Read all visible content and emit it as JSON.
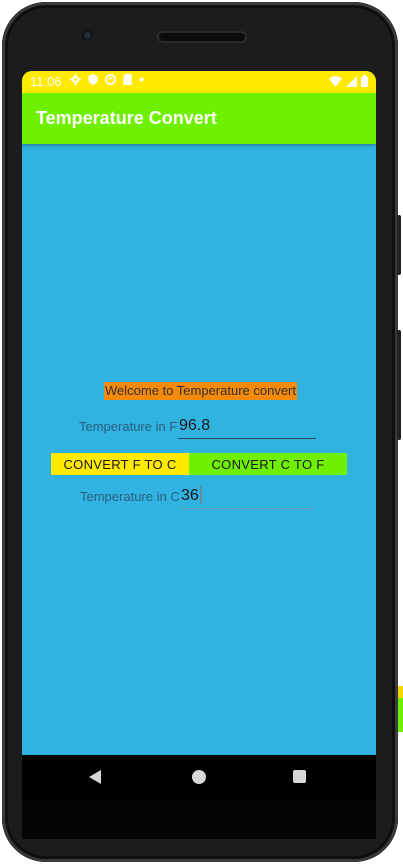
{
  "status_bar": {
    "time": "11:06",
    "left_icons": [
      "gear-icon",
      "shield-icon",
      "sync-icon",
      "sd-card-icon",
      "dot-icon"
    ],
    "right_icons": [
      "wifi-icon",
      "signal-icon",
      "battery-icon"
    ]
  },
  "app_bar": {
    "title": "Temperature Convert"
  },
  "main": {
    "welcome_text": "Welcome to Temperature convert",
    "fahrenheit_label": "Temperature in F",
    "fahrenheit_value": "96.8",
    "button_f_to_c": "CONVERT F TO C",
    "button_c_to_f": "CONVERT C TO F",
    "celsius_label": "Temperature in C",
    "celsius_value": "36"
  },
  "navigation": {
    "back": "back-icon",
    "home": "home-icon",
    "recents": "recents-icon"
  },
  "colors": {
    "status_bar": "#ffea00",
    "app_bar": "#6ff000",
    "screen_background": "#31b3e1",
    "welcome_highlight": "#f5890a",
    "button_f_to_c": "#ffea00",
    "button_c_to_f": "#6ff000"
  }
}
